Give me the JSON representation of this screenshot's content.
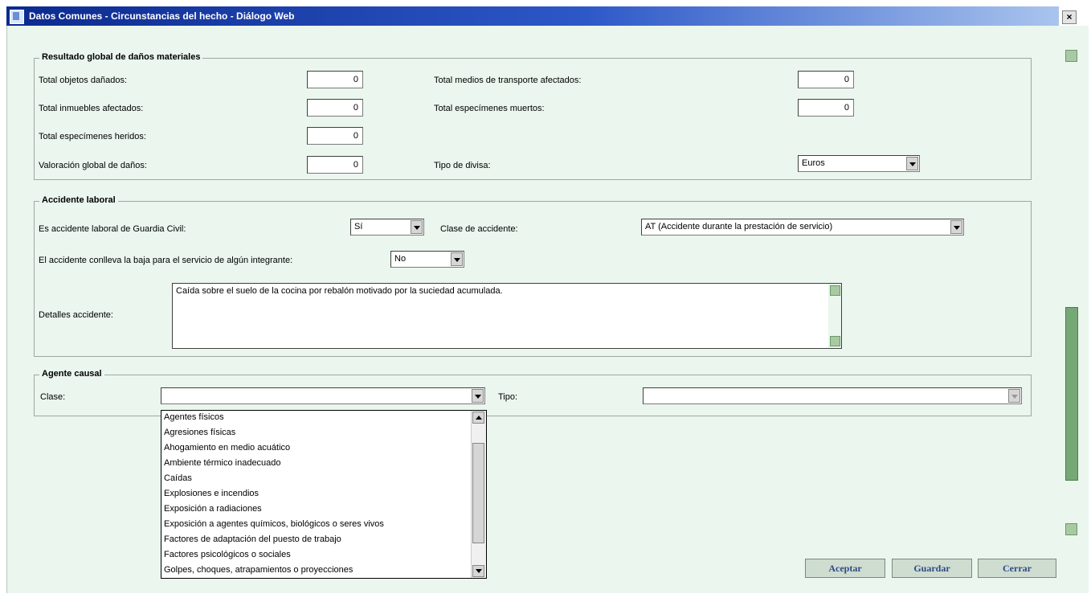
{
  "window": {
    "title": "Datos Comunes - Circunstancias del hecho - Diálogo Web",
    "close_label": "×"
  },
  "danos": {
    "legend": "Resultado global de daños materiales",
    "total_objetos_label": "Total objetos dañados:",
    "total_objetos_value": "0",
    "total_medios_label": "Total medios de transporte afectados:",
    "total_medios_value": "0",
    "total_inmuebles_label": "Total inmuebles afectados:",
    "total_inmuebles_value": "0",
    "total_muertos_label": "Total especímenes muertos:",
    "total_muertos_value": "0",
    "total_heridos_label": "Total especímenes heridos:",
    "total_heridos_value": "0",
    "valoracion_label": "Valoración global de daños:",
    "valoracion_value": "0",
    "divisa_label": "Tipo de divisa:",
    "divisa_value": "Euros"
  },
  "accidente": {
    "legend": "Accidente laboral",
    "es_accidente_label": "Es accidente laboral de Guardia Civil:",
    "es_accidente_value": "Sí",
    "clase_label": "Clase de accidente:",
    "clase_value": "AT (Accidente durante la prestación de servicio)",
    "baja_label": "El accidente conlleva la baja para el servicio de algún integrante:",
    "baja_value": "No",
    "detalles_label": "Detalles accidente:",
    "detalles_value": "Caída sobre el suelo de la cocina por rebalón motivado por la suciedad acumulada."
  },
  "agente": {
    "legend": "Agente causal",
    "clase_label": "Clase:",
    "clase_value": "",
    "tipo_label": "Tipo:",
    "tipo_value": "",
    "options": [
      "Agentes físicos",
      "Agresiones físicas",
      "Ahogamiento en medio acuático",
      "Ambiente térmico inadecuado",
      "Caídas",
      "Explosiones e incendios",
      "Exposición a radiaciones",
      "Exposición a agentes químicos, biológicos o seres vivos",
      "Factores de adaptación del puesto de trabajo",
      "Factores psicológicos o sociales",
      "Golpes, choques, atrapamientos o proyecciones"
    ]
  },
  "buttons": {
    "aceptar": "Aceptar",
    "guardar": "Guardar",
    "cerrar": "Cerrar"
  }
}
